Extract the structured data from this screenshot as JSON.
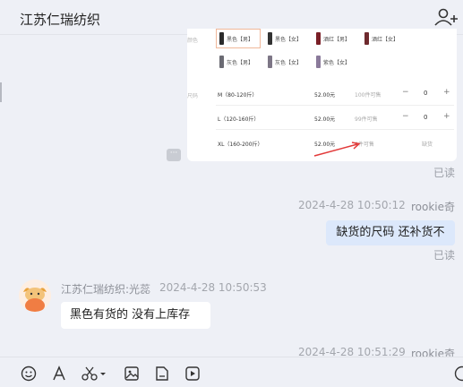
{
  "header": {
    "title": "江苏仁瑞纺织"
  },
  "product_card": {
    "color_label": "颜色",
    "size_label": "尺码",
    "colors": [
      {
        "label": "黑色【男】",
        "color": "#2b2b2b",
        "selected": true
      },
      {
        "label": "黑色【女】",
        "color": "#333333"
      },
      {
        "label": "酒红【男】",
        "color": "#7a1f27"
      },
      {
        "label": "酒红【女】",
        "color": "#6e2a2e"
      },
      {
        "label": "灰色【男】",
        "color": "#6b6b73"
      },
      {
        "label": "灰色【女】",
        "color": "#7d7686"
      },
      {
        "label": "紫色【女】",
        "color": "#8a7a9a"
      }
    ],
    "sizes": [
      {
        "size": "M（80-120斤）",
        "price": "52.00元",
        "stock": "100件可售",
        "qty": "0"
      },
      {
        "size": "L（120-160斤）",
        "price": "52.00元",
        "stock": "99件可售",
        "qty": "0"
      },
      {
        "size": "XL（160-200斤）",
        "price": "52.00元",
        "stock": "0件可售",
        "status": "缺货"
      }
    ],
    "more_label": "···"
  },
  "messages": [
    {
      "read_status": "已读"
    },
    {
      "timestamp": "2024-4-28 10:50:12",
      "sender": "rookie奇",
      "text": "缺货的尺码 还补货不",
      "read_status": "已读"
    },
    {
      "sender": "江苏仁瑞纺织:光蕊",
      "timestamp": "2024-4-28 10:50:53",
      "text": "黑色有货的  没有上库存"
    },
    {
      "timestamp": "2024-4-28 10:51:29",
      "sender": "rookie奇"
    }
  ],
  "colors": {
    "accent_bubble": "#dce8fb",
    "background": "#eef0f6",
    "annotation": "#e23a3a"
  }
}
